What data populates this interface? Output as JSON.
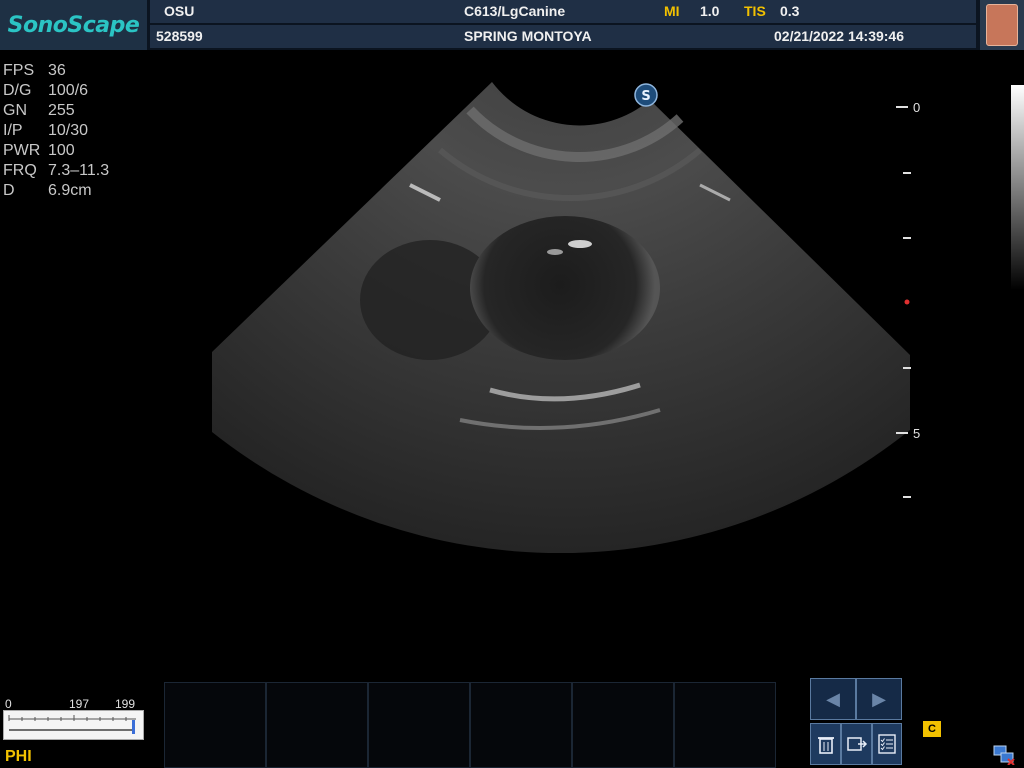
{
  "brand": {
    "logo_text": "SonoScape"
  },
  "header": {
    "institution": "OSU",
    "probe_preset": "C613/LgCanine",
    "mi_label": "MI",
    "mi_value": "1.0",
    "tis_label": "TIS",
    "tis_value": "0.3",
    "patient_id": "528599",
    "patient_name": "SPRING MONTOYA",
    "datetime": "02/21/2022 14:39:46"
  },
  "params": [
    {
      "key": "FPS",
      "value": "36"
    },
    {
      "key": "D/G",
      "value": "100/6"
    },
    {
      "key": "GN",
      "value": "255"
    },
    {
      "key": "I/P",
      "value": "10/30"
    },
    {
      "key": "PWR",
      "value": "100"
    },
    {
      "key": "FRQ",
      "value": "7.3–11.3"
    },
    {
      "key": "D",
      "value": "6.9cm"
    }
  ],
  "depth_scale": {
    "label_top": "0",
    "label_mid": "5"
  },
  "cine": {
    "start": "0",
    "current": "197",
    "end": "199",
    "current_fraction": 0.99
  },
  "mode_label": "PHI",
  "icons": {
    "logo_badge": "S",
    "prev": "prev-icon",
    "next": "next-icon",
    "delete": "trash-icon",
    "export": "export-icon",
    "checklist": "checklist-icon",
    "cine": "cine-icon",
    "network": "network-icon"
  },
  "colors": {
    "accent": "#f2c100",
    "brand": "#2bc4c4",
    "header_bg": "#1f2f45"
  }
}
